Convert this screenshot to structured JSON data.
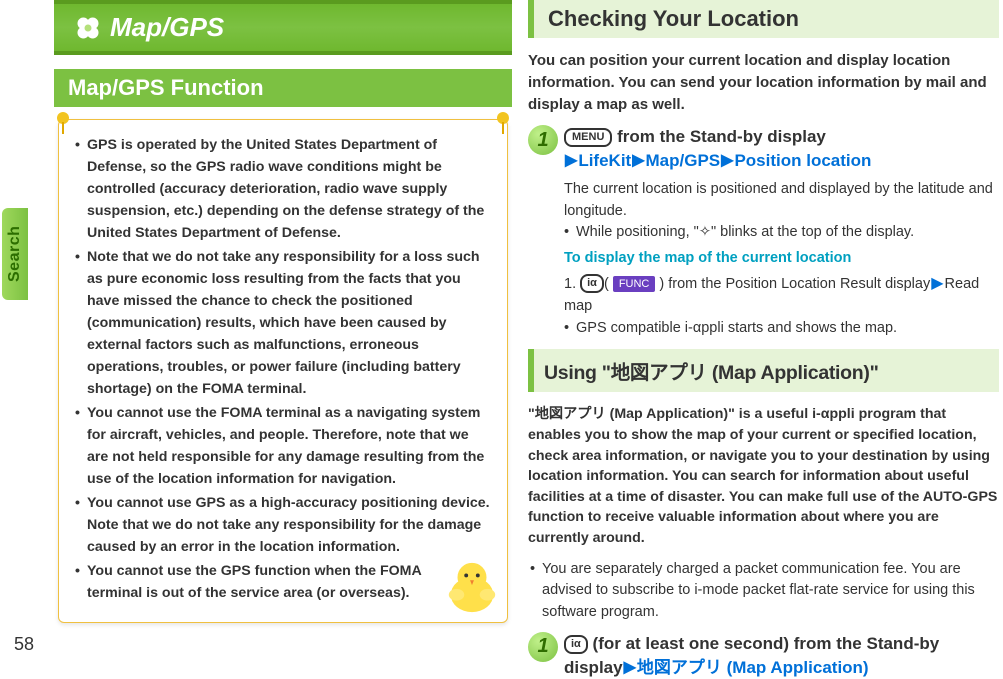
{
  "sidebar": {
    "search_label": "Search",
    "page_number": "58"
  },
  "left": {
    "banner_title": "Map/GPS",
    "section1_heading": "Map/GPS Function",
    "bullets": [
      "GPS is operated by the United States Department of Defense, so the GPS radio wave conditions might be controlled (accuracy deterioration, radio wave supply suspension, etc.) depending on the defense strategy of the United States Department of Defense.",
      "Note that we do not take any responsibility for a loss such as pure economic loss resulting from the facts that you have missed the chance to check the positioned (communication) results, which have been caused by external factors such as malfunctions, erroneous operations, troubles, or power failure (including battery shortage) on the FOMA terminal.",
      "You cannot use the FOMA terminal as a navigating system for aircraft, vehicles, and people. Therefore, note that we are not held responsible for any damage resulting from the use of the location information for navigation.",
      "You cannot use GPS as a high-accuracy positioning device. Note that we do not take any responsibility for the damage caused by an error in the location information.",
      "You cannot use the GPS function when the FOMA terminal is out of the service area (or overseas)."
    ]
  },
  "right": {
    "check_heading": "Checking Your Location",
    "check_intro": "You can position your current location and display location information. You can send your location information by mail and display a map as well.",
    "menu_key": "MENU",
    "step1_part1": " from the Stand-by display",
    "step1_nav1": "LifeKit",
    "step1_nav2": "Map/GPS",
    "step1_nav3": "Position location",
    "step1_body": "The current location is positioned and displayed by the latitude and longitude.",
    "step1_note": "While positioning, \"✧\" blinks at the top of the display.",
    "cyan_heading": "To display the map of the current location",
    "ir_key": "iα",
    "func_label": "FUNC",
    "sub1a": "1. ",
    "sub1b": " from the Position Location Result display",
    "sub1c": "Read map",
    "sub2": "GPS compatible i-αppli starts and shows the map.",
    "using_heading": "Using \"地図アプリ (Map Application)\"",
    "using_intro": "\"地図アプリ (Map Application)\" is a useful i-αppli program that enables you to show the map of your current or specified location, check area information, or navigate you to your destination by using location information. You can search for information about useful facilities at a time of disaster. You can make full use of the AUTO-GPS function to receive valuable information about where you are currently around.",
    "packet_note": "You are separately charged a packet communication fee. You are advised to subscribe to i-mode packet flat-rate service for using this software program.",
    "step2_a": " (for at least one second) from the Stand-by display",
    "step2_b": "地図アプリ (Map Application)"
  }
}
